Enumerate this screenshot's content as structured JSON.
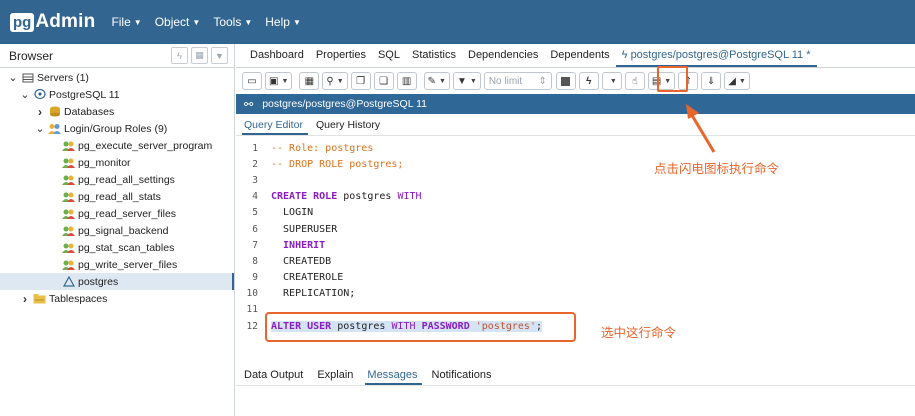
{
  "navbar": {
    "logo_pg": "pg",
    "logo_admin": "Admin",
    "menu": [
      "File",
      "Object",
      "Tools",
      "Help"
    ]
  },
  "browser": {
    "title": "Browser",
    "tree": [
      {
        "label": "Servers (1)",
        "icon": "server-group-icon",
        "level": 0,
        "twisty": "down"
      },
      {
        "label": "PostgreSQL 11",
        "icon": "elephant-icon",
        "level": 1,
        "twisty": "down"
      },
      {
        "label": "Databases",
        "icon": "database-icon",
        "level": 2,
        "twisty": "right"
      },
      {
        "label": "Login/Group Roles (9)",
        "icon": "roles-icon",
        "level": 2,
        "twisty": "down"
      },
      {
        "label": "pg_execute_server_program",
        "icon": "group-role-icon",
        "level": 3
      },
      {
        "label": "pg_monitor",
        "icon": "group-role-icon",
        "level": 3
      },
      {
        "label": "pg_read_all_settings",
        "icon": "group-role-icon",
        "level": 3
      },
      {
        "label": "pg_read_all_stats",
        "icon": "group-role-icon",
        "level": 3
      },
      {
        "label": "pg_read_server_files",
        "icon": "group-role-icon",
        "level": 3
      },
      {
        "label": "pg_signal_backend",
        "icon": "group-role-icon",
        "level": 3
      },
      {
        "label": "pg_stat_scan_tables",
        "icon": "group-role-icon",
        "level": 3
      },
      {
        "label": "pg_write_server_files",
        "icon": "group-role-icon",
        "level": 3
      },
      {
        "label": "postgres",
        "icon": "login-role-icon",
        "level": 3,
        "selected": true
      },
      {
        "label": "Tablespaces",
        "icon": "tablespace-folder-icon",
        "level": 1,
        "twisty": "right"
      }
    ]
  },
  "main": {
    "tabs": [
      "Dashboard",
      "Properties",
      "SQL",
      "Statistics",
      "Dependencies",
      "Dependents",
      "postgres/postgres@PostgreSQL 11 *"
    ],
    "toolbar": {
      "limit_placeholder": "No limit"
    },
    "connection": "postgres/postgres@PostgreSQL 11",
    "subtabs": [
      "Query Editor",
      "Query History"
    ],
    "code": [
      {
        "n": "1",
        "parts": [
          {
            "t": "-- Role: postgres",
            "c": "cm"
          }
        ]
      },
      {
        "n": "2",
        "parts": [
          {
            "t": "-- DROP ROLE postgres;",
            "c": "cm"
          }
        ]
      },
      {
        "n": "3",
        "parts": []
      },
      {
        "n": "4",
        "parts": [
          {
            "t": "CREATE ROLE",
            "c": "kw"
          },
          {
            "t": " postgres ",
            "c": "tx"
          },
          {
            "t": "WITH",
            "c": "kw2"
          }
        ]
      },
      {
        "n": "5",
        "parts": [
          {
            "t": "  LOGIN",
            "c": "tx"
          }
        ]
      },
      {
        "n": "6",
        "parts": [
          {
            "t": "  SUPERUSER",
            "c": "tx"
          }
        ]
      },
      {
        "n": "7",
        "parts": [
          {
            "t": "  INHERIT",
            "c": "kw"
          }
        ]
      },
      {
        "n": "8",
        "parts": [
          {
            "t": "  CREATEDB",
            "c": "tx"
          }
        ]
      },
      {
        "n": "9",
        "parts": [
          {
            "t": "  CREATEROLE",
            "c": "tx"
          }
        ]
      },
      {
        "n": "10",
        "parts": [
          {
            "t": "  REPLICATION;",
            "c": "tx"
          }
        ]
      },
      {
        "n": "11",
        "parts": []
      },
      {
        "n": "12",
        "hl": true,
        "parts": [
          {
            "t": "ALTER USER",
            "c": "kw"
          },
          {
            "t": " postgres ",
            "c": "tx"
          },
          {
            "t": "WITH",
            "c": "kw2"
          },
          {
            "t": " ",
            "c": "tx"
          },
          {
            "t": "PASSWORD",
            "c": "kw"
          },
          {
            "t": " ",
            "c": "tx"
          },
          {
            "t": "'postgres'",
            "c": "str"
          },
          {
            "t": ";",
            "c": "tx"
          }
        ]
      }
    ],
    "output_tabs": [
      "Data Output",
      "Explain",
      "Messages",
      "Notifications"
    ]
  },
  "annotations": {
    "flash": "点击闪电图标执行命令",
    "select": "选中这行命令"
  },
  "colors": {
    "navbar": "#326690",
    "annotation": "#e8652b",
    "selection": "#dde8f3"
  }
}
